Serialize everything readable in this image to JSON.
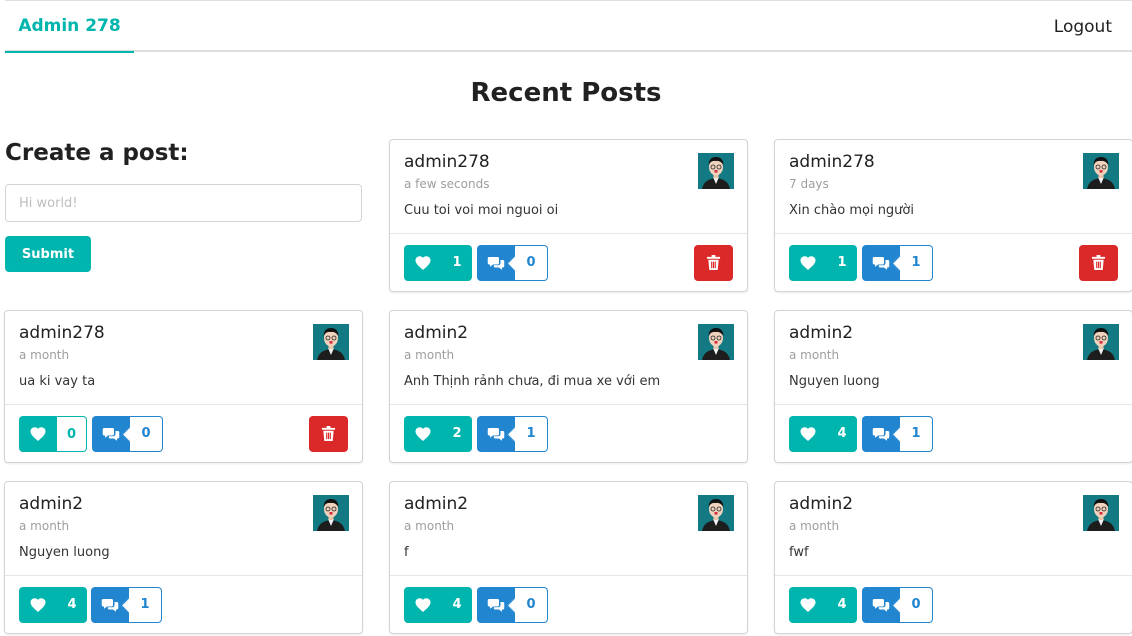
{
  "nav": {
    "brand": "Admin 278",
    "logout": "Logout"
  },
  "main": {
    "heading": "Recent Posts"
  },
  "create": {
    "title": "Create a post:",
    "placeholder": "Hi world!",
    "submit": "Submit"
  },
  "icons": {
    "like": "heart-icon",
    "comment": "comments-icon",
    "delete": "trash-icon",
    "avatar": "user-avatar"
  },
  "colors": {
    "primary": "#00b5ad",
    "like": "#00b5ad",
    "comment": "#2185d0",
    "delete": "#db2828",
    "avatar_bg": "#137a84"
  },
  "posts": [
    {
      "author": "admin278",
      "time": "a few seconds",
      "content": "Cuu toi voi moi nguoi oi",
      "likes": "1",
      "comments": "0",
      "liked": true,
      "can_delete": true
    },
    {
      "author": "admin278",
      "time": "7 days",
      "content": "Xin chào mọi người",
      "likes": "1",
      "comments": "1",
      "liked": true,
      "can_delete": true
    },
    {
      "author": "admin278",
      "time": "a month",
      "content": "ua ki vay ta",
      "likes": "0",
      "comments": "0",
      "liked": false,
      "can_delete": true
    },
    {
      "author": "admin2",
      "time": "a month",
      "content": "Anh Thịnh rảnh chưa, đi mua xe với em",
      "likes": "2",
      "comments": "1",
      "liked": true,
      "can_delete": false
    },
    {
      "author": "admin2",
      "time": "a month",
      "content": "Nguyen luong",
      "likes": "4",
      "comments": "1",
      "liked": true,
      "can_delete": false
    },
    {
      "author": "admin2",
      "time": "a month",
      "content": "Nguyen luong",
      "likes": "4",
      "comments": "1",
      "liked": true,
      "can_delete": false
    },
    {
      "author": "admin2",
      "time": "a month",
      "content": "f",
      "likes": "4",
      "comments": "0",
      "liked": true,
      "can_delete": false
    },
    {
      "author": "admin2",
      "time": "a month",
      "content": "fwf",
      "likes": "4",
      "comments": "0",
      "liked": true,
      "can_delete": false
    }
  ]
}
